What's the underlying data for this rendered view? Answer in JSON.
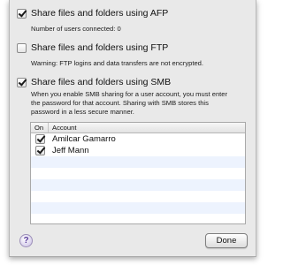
{
  "afp": {
    "label": "Share files and folders using AFP",
    "checked": true,
    "users_connected": "Number of users connected: 0"
  },
  "ftp": {
    "label": "Share files and folders using FTP",
    "checked": false,
    "warning": "Warning: FTP logins and data transfers are not encrypted."
  },
  "smb": {
    "label": "Share files and folders using SMB",
    "checked": true,
    "description_lines": [
      "When you enable SMB sharing for a user account, you must enter",
      "the password for that account. Sharing with SMB stores this",
      "password in a less secure manner."
    ]
  },
  "accounts_table": {
    "headers": {
      "on": "On",
      "account": "Account"
    },
    "rows": [
      {
        "on": true,
        "account": "Amilcar Gamarro"
      },
      {
        "on": true,
        "account": "Jeff Mann"
      }
    ]
  },
  "footer": {
    "help_label": "?",
    "done_label": "Done"
  }
}
